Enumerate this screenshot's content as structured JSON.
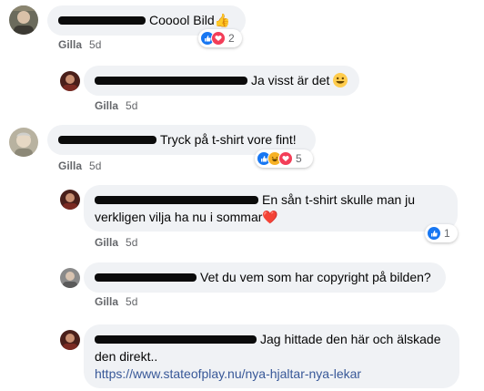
{
  "comments": [
    {
      "text": "Cooool Bild",
      "emoji": "👍",
      "like_label": "Gilla",
      "time": "5d",
      "reaction_count": "2"
    },
    {
      "text": "Ja visst är det",
      "like_label": "Gilla",
      "time": "5d"
    },
    {
      "text": "Tryck på t-shirt vore fint!",
      "like_label": "Gilla",
      "time": "5d",
      "reaction_count": "5"
    },
    {
      "text_line1": "En sån t-shirt skulle man ju",
      "text_line2": "verkligen vilja ha nu i sommar",
      "emoji": "❤️",
      "like_label": "Gilla",
      "time": "5d",
      "reaction_count": "1"
    },
    {
      "text": "Vet du vem som har copyright på bilden?",
      "like_label": "Gilla",
      "time": "5d"
    },
    {
      "text_line1": "Jag hittade den här och älskade",
      "text_line2": "den direkt..",
      "link": "https://www.stateofplay.nu/nya-hjaltar-nya-lekar"
    }
  ],
  "colors": {
    "like_blue": "#1877f2",
    "love_red": "#f33e58",
    "haha_yellow": "#f7b125",
    "bubble_bg": "#f0f2f5",
    "meta_gray": "#65676b",
    "link_blue": "#385898"
  }
}
